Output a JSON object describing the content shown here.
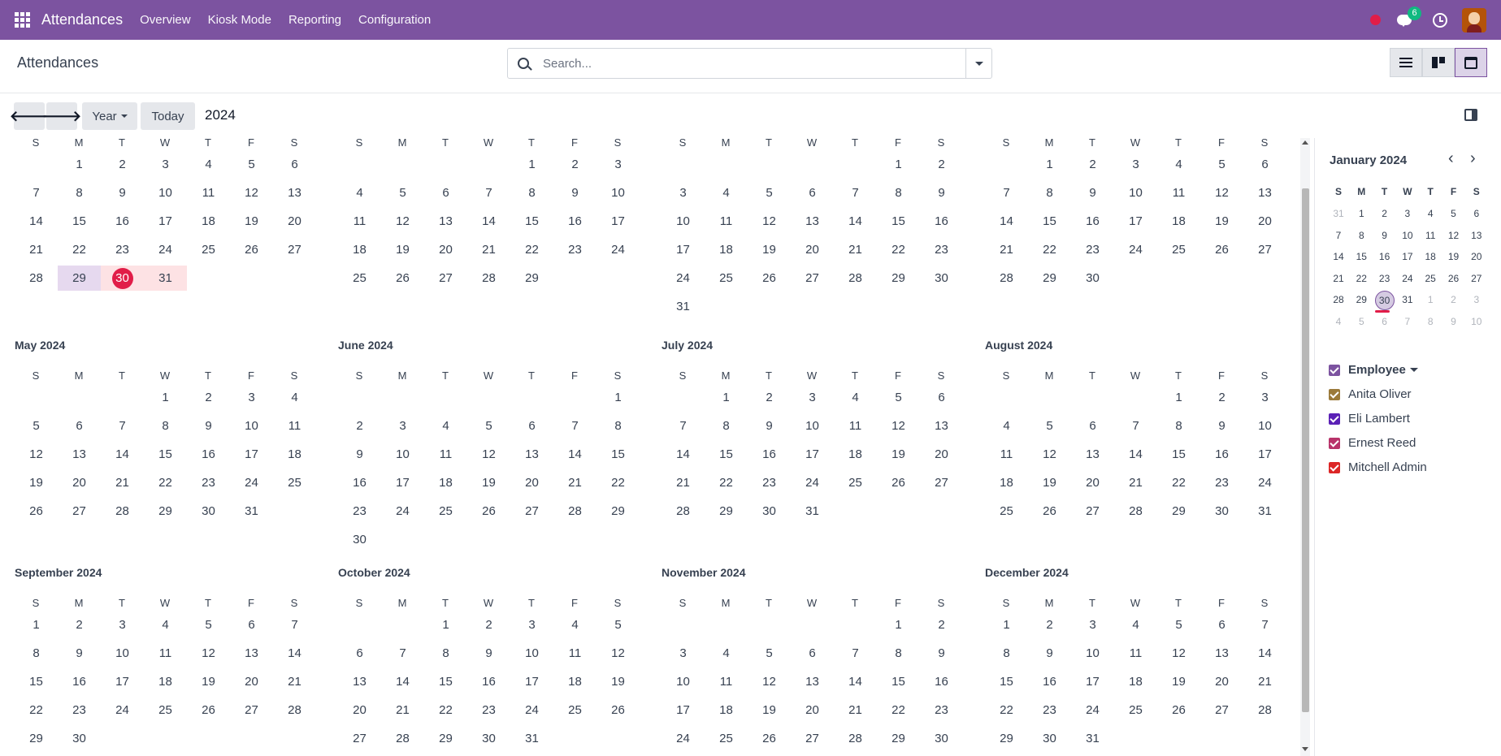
{
  "app": {
    "brand": "Attendances",
    "menu": [
      "Overview",
      "Kiosk Mode",
      "Reporting",
      "Configuration"
    ],
    "chat_badge": "6"
  },
  "control_panel": {
    "title": "Attendances",
    "search_placeholder": "Search..."
  },
  "toolbar": {
    "prev": "🡐",
    "next": "🡒",
    "scale": "Year",
    "today": "Today",
    "period": "2024"
  },
  "weekdays": [
    "S",
    "M",
    "T",
    "W",
    "T",
    "F",
    "S"
  ],
  "year": {
    "months": [
      {
        "title": "",
        "start": 1,
        "days": 31
      },
      {
        "title": "",
        "start": 4,
        "days": 29
      },
      {
        "title": "",
        "start": 5,
        "days": 31
      },
      {
        "title": "",
        "start": 1,
        "days": 30
      },
      {
        "title": "May 2024",
        "start": 3,
        "days": 31
      },
      {
        "title": "June 2024",
        "start": 6,
        "days": 30
      },
      {
        "title": "July 2024",
        "start": 1,
        "days": 31
      },
      {
        "title": "August 2024",
        "start": 4,
        "days": 31
      },
      {
        "title": "September 2024",
        "start": 0,
        "days": 30
      },
      {
        "title": "October 2024",
        "start": 2,
        "days": 31
      },
      {
        "title": "November 2024",
        "start": 5,
        "days": 30
      },
      {
        "title": "December 2024",
        "start": 0,
        "days": 31
      }
    ],
    "today": {
      "month": 0,
      "day": 30
    },
    "purple_days": {
      "month": 0,
      "days": [
        29
      ]
    },
    "pink_days": {
      "month": 0,
      "days": [
        31
      ]
    }
  },
  "mini_calendar": {
    "title": "January 2024",
    "prev": "‹",
    "next": "›",
    "weekdays": [
      "S",
      "M",
      "T",
      "W",
      "T",
      "F",
      "S"
    ],
    "rows": [
      [
        "31",
        "1",
        "2",
        "3",
        "4",
        "5",
        "6"
      ],
      [
        "7",
        "8",
        "9",
        "10",
        "11",
        "12",
        "13"
      ],
      [
        "14",
        "15",
        "16",
        "17",
        "18",
        "19",
        "20"
      ],
      [
        "21",
        "22",
        "23",
        "24",
        "25",
        "26",
        "27"
      ],
      [
        "28",
        "29",
        "30",
        "31",
        "1",
        "2",
        "3"
      ],
      [
        "4",
        "5",
        "6",
        "7",
        "8",
        "9",
        "10"
      ]
    ],
    "muted": [
      [
        0,
        0
      ],
      [
        4,
        4
      ],
      [
        4,
        5
      ],
      [
        4,
        6
      ],
      [
        5,
        0
      ],
      [
        5,
        1
      ],
      [
        5,
        2
      ],
      [
        5,
        3
      ],
      [
        5,
        4
      ],
      [
        5,
        5
      ],
      [
        5,
        6
      ]
    ],
    "today": [
      4,
      2
    ]
  },
  "filters": {
    "header": "Employee",
    "header_color": "#7c53a0",
    "items": [
      {
        "label": "Anita Oliver",
        "color": "#9b7a3a"
      },
      {
        "label": "Eli Lambert",
        "color": "#5b21b6"
      },
      {
        "label": "Ernest Reed",
        "color": "#b8336a"
      },
      {
        "label": "Mitchell Admin",
        "color": "#dc2626"
      }
    ]
  }
}
